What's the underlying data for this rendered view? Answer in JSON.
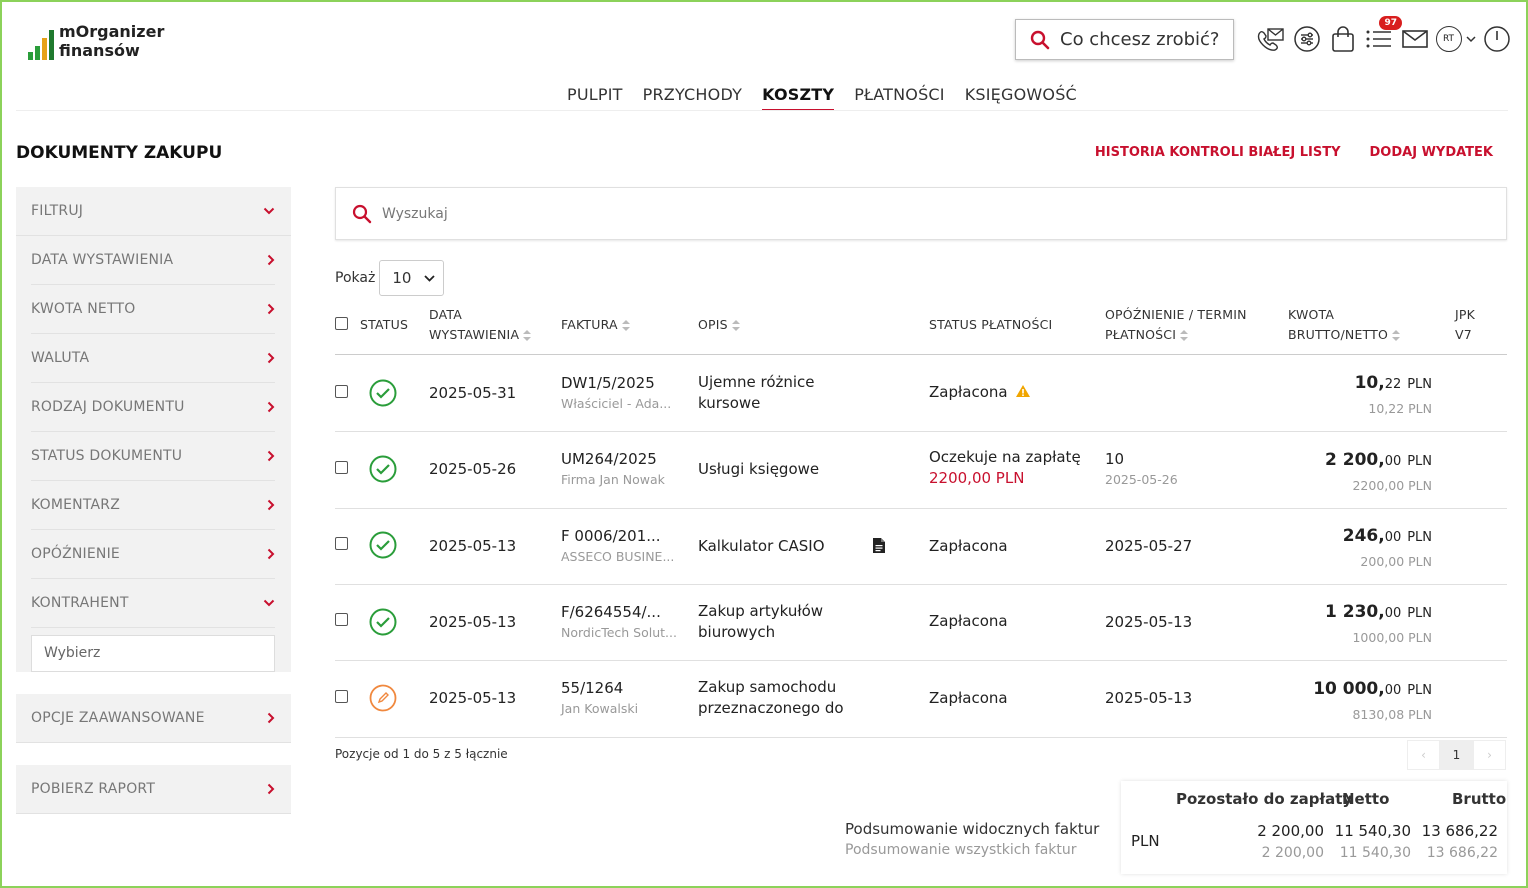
{
  "app": {
    "logo_line1": "mOrganizer",
    "logo_line2": "finansów",
    "command_placeholder": "Co chcesz zrobić?",
    "badge_count": "97",
    "avatar_initials": "RT",
    "colors": {
      "accent": "#c8102e",
      "ok": "#2a9d3a",
      "edit": "#f0883e",
      "frame": "#8cd25a"
    }
  },
  "nav": [
    {
      "label": "PULPIT"
    },
    {
      "label": "PRZYCHODY"
    },
    {
      "label": "KOSZTY",
      "active": true
    },
    {
      "label": "PŁATNOŚCI"
    },
    {
      "label": "KSIĘGOWOŚĆ"
    }
  ],
  "page": {
    "title": "DOKUMENTY ZAKUPU",
    "link_history": "HISTORIA KONTROLI BIAŁEJ LISTY",
    "link_add": "DODAJ WYDATEK"
  },
  "sidebar": {
    "filter": "FILTRUJ",
    "items": [
      "DATA WYSTAWIENIA",
      "KWOTA NETTO",
      "WALUTA",
      "RODZAJ DOKUMENTU",
      "STATUS DOKUMENTU",
      "KOMENTARZ",
      "OPÓŹNIENIE",
      "KONTRAHENT"
    ],
    "contractor_placeholder": "Wybierz",
    "advanced": "OPCJE ZAAWANSOWANE",
    "report": "POBIERZ RAPORT"
  },
  "search": {
    "placeholder": "Wyszukaj"
  },
  "show": {
    "label": "Pokaż",
    "value": "10"
  },
  "table": {
    "headers": {
      "status": "STATUS",
      "date_1": "DATA",
      "date_2": "WYSTAWIENIA",
      "invoice": "FAKTURA",
      "desc": "OPIS",
      "pay_status": "STATUS PŁATNOŚCI",
      "delay_1": "OPÓŹNIENIE / TERMIN",
      "delay_2": "PŁATNOŚCI",
      "amount_1": "KWOTA",
      "amount_2": "BRUTTO/NETTO",
      "jpk_1": "JPK",
      "jpk_2": "V7"
    },
    "rows": [
      {
        "status": "ok",
        "date": "2025-05-31",
        "invoice": "DW1/5/2025",
        "party": "Właściciel - Ada...",
        "desc_1": "Ujemne różnice",
        "desc_2": "kursowe",
        "pay": "Zapłacona",
        "pay_warn": true,
        "delay": "",
        "delay_sub": "",
        "gross_int": "10,",
        "gross_dec": "22",
        "cur": "PLN",
        "net": "10,22 PLN"
      },
      {
        "status": "ok",
        "date": "2025-05-26",
        "invoice": "UM264/2025",
        "party": "Firma Jan Nowak",
        "desc_1": "Usługi księgowe",
        "desc_2": "",
        "pay": "Oczekuje na zapłatę",
        "pay_sub": "2200,00 PLN",
        "delay": "10",
        "delay_sub": "2025-05-26",
        "gross_int": "2 200,",
        "gross_dec": "00",
        "cur": "PLN",
        "net": "2200,00 PLN"
      },
      {
        "status": "ok",
        "date": "2025-05-13",
        "invoice": "F 0006/201...",
        "party": "ASSECO BUSINE...",
        "desc_1": "Kalkulator CASIO",
        "desc_2": "",
        "attachment": true,
        "pay": "Zapłacona",
        "delay": "2025-05-27",
        "delay_sub": "",
        "gross_int": "246,",
        "gross_dec": "00",
        "cur": "PLN",
        "net": "200,00 PLN"
      },
      {
        "status": "ok",
        "date": "2025-05-13",
        "invoice": "F/6264554/...",
        "party": "NordicTech Solut...",
        "desc_1": "Zakup artykułów",
        "desc_2": "biurowych",
        "pay": "Zapłacona",
        "delay": "2025-05-13",
        "delay_sub": "",
        "gross_int": "1 230,",
        "gross_dec": "00",
        "cur": "PLN",
        "net": "1000,00 PLN"
      },
      {
        "status": "edit",
        "date": "2025-05-13",
        "invoice": "55/1264",
        "party": "Jan Kowalski",
        "desc_1": "Zakup samochodu",
        "desc_2": "przeznaczonego do",
        "pay": "Zapłacona",
        "delay": "2025-05-13",
        "delay_sub": "",
        "gross_int": "10 000,",
        "gross_dec": "00",
        "cur": "PLN",
        "net": "8130,08 PLN"
      }
    ]
  },
  "footer": {
    "info": "Pozycje od 1 do 5 z 5 łącznie",
    "page": "1"
  },
  "summary": {
    "visible_label": "Podsumowanie widocznych faktur",
    "all_label": "Podsumowanie wszystkich faktur",
    "h_remaining": "Pozostało do zapłaty",
    "h_net": "Netto",
    "h_gross": "Brutto",
    "currency": "PLN",
    "visible": {
      "remaining": "2 200,00",
      "net": "11 540,30",
      "gross": "13 686,22"
    },
    "all": {
      "remaining": "2 200,00",
      "net": "11 540,30",
      "gross": "13 686,22"
    }
  }
}
